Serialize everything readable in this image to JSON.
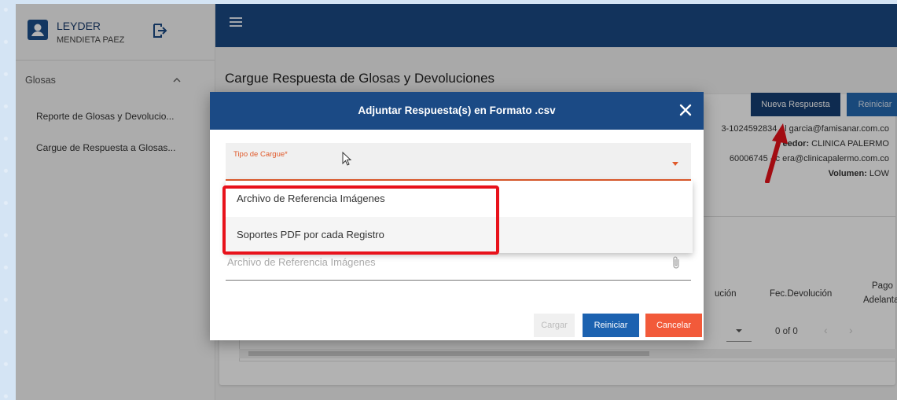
{
  "user": {
    "first_name": "LEYDER",
    "last_name": "MENDIETA PAEZ"
  },
  "sidebar": {
    "group_label": "Glosas",
    "items": [
      {
        "label": "Reporte de Glosas y Devolucio..."
      },
      {
        "label": "Cargue de Respuesta a Glosas..."
      }
    ]
  },
  "page": {
    "title": "Cargue Respuesta de Glosas y Devoluciones",
    "nueva_respuesta_label": "Nueva Respuesta",
    "reiniciar_label": "Reiniciar",
    "info": {
      "line1": "3-1024592834 - l garcia@famisanar.com.co",
      "line2_key": "eedor:",
      "line2_value": " CLINICA PALERMO",
      "line3": "60006745 - c  era@clinicapalermo.com.co",
      "line4_key": "Volumen:",
      "line4_value": " LOW"
    },
    "table": {
      "headers": [
        "ución",
        "Fec.Devolución",
        "Pago",
        "Adelanta"
      ],
      "pager": "0 of 0",
      "prev": "‹",
      "next": "›"
    }
  },
  "modal": {
    "title": "Adjuntar Respuesta(s) en Formato .csv",
    "select_label": "Tipo de Cargue*",
    "options": [
      {
        "label": "Archivo de Referencia Imágenes"
      },
      {
        "label": "Soportes PDF por cada Registro"
      }
    ],
    "file_placeholder": "Archivo de Referencia Imágenes",
    "buttons": {
      "cargar": "Cargar",
      "reiniciar": "Reiniciar",
      "cancelar": "Cancelar"
    }
  },
  "colors": {
    "primary": "#1b4a85",
    "accent_orange": "#e05a2b",
    "cancel": "#f25a3a",
    "highlight_red": "#e8121b"
  }
}
